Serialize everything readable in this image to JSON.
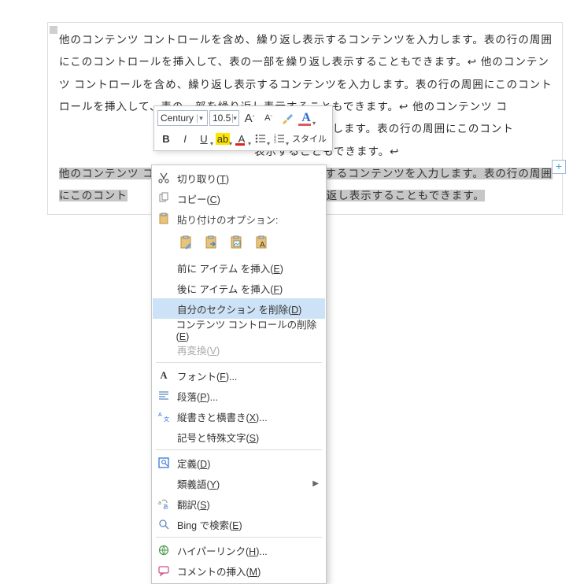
{
  "document": {
    "p1": "他のコンテンツ コントロールを含め、繰り返し表示するコンテンツを入力します。表の行の周囲にこのコントロールを挿入して、表の一部を繰り返し表示することもできます。↩",
    "p2": "他のコンテンツ コントロールを含め、繰り返し表示するコンテンツを入力します。表の行の周囲にこのコントロールを挿入して、表の一部を繰り返し表示することもできます。↩",
    "p3a": "他のコンテンツ コ",
    "p3b": "ンテンツを入力します。表の行の周囲にこのコント",
    "p3c": "表示することもできます。↩",
    "sel1": "他のコンテンツ コントロールを含め、繰り返し表示するコンテンツを入力します。表の行の周囲にこのコント",
    "sel2": "繰り返し表示することもできます。",
    "add": "+"
  },
  "mini": {
    "font": "Century",
    "size": "10.5",
    "grow": "A",
    "shrink": "A",
    "brush": "✎",
    "styleA": "A",
    "bold": "B",
    "italic": "I",
    "underline": "U",
    "highlight": "ab",
    "fontcolor": "A",
    "style_label": "スタイル"
  },
  "ctx": {
    "cut": "切り取り(",
    "cut_k": "T",
    "cut_e": ")",
    "copy": "コピー(",
    "copy_k": "C",
    "copy_e": ")",
    "paste_hdr": "貼り付けのオプション:",
    "ins_before": "前に アイテム を挿入(",
    "ins_before_k": "E",
    "ins_before_e": ")",
    "ins_after": "後に アイテム を挿入(",
    "ins_after_k": "F",
    "ins_after_e": ")",
    "del_section": "自分のセクション を削除(",
    "del_section_k": "D",
    "del_section_e": ")",
    "del_cc": "コンテンツ コントロールの削除(",
    "del_cc_k": "E",
    "del_cc_e": ")",
    "reconv": "再変換(",
    "reconv_k": "V",
    "reconv_e": ")",
    "font": "フォント(",
    "font_k": "F",
    "font_e": ")...",
    "para": "段落(",
    "para_k": "P",
    "para_e": ")...",
    "vert": "縦書きと横書き(",
    "vert_k": "X",
    "vert_e": ")...",
    "sym": "記号と特殊文字(",
    "sym_k": "S",
    "sym_e": ")",
    "define": "定義(",
    "define_k": "D",
    "define_e": ")",
    "syn": "類義語(",
    "syn_k": "Y",
    "syn_e": ")",
    "trans": "翻訳(",
    "trans_k": "S",
    "trans_e": ")",
    "bing": "Bing で検索(",
    "bing_k": "E",
    "bing_e": ")",
    "link": "ハイパーリンク(",
    "link_k": "H",
    "link_e": ")...",
    "comment": "コメントの挿入(",
    "comment_k": "M",
    "comment_e": ")"
  }
}
